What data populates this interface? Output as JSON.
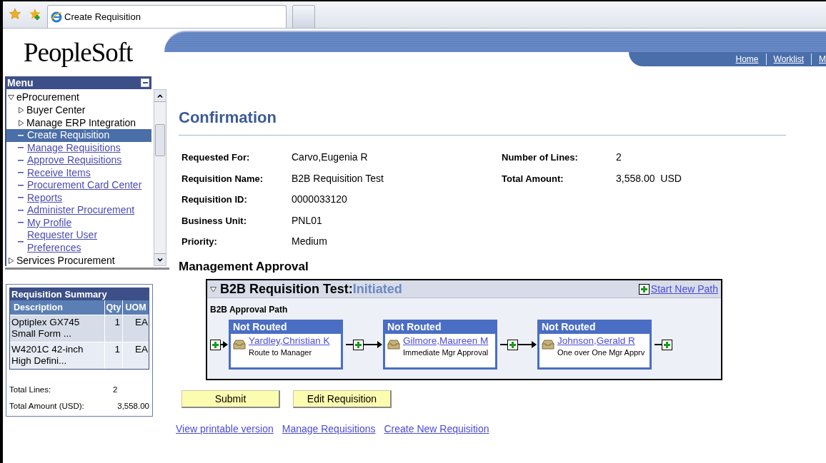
{
  "browser": {
    "tab_title": "Create Requisition"
  },
  "header": {
    "logo": "PeopleSoft",
    "nav_links": [
      "Home",
      "Worklist",
      "M"
    ]
  },
  "menu": {
    "title": "Menu",
    "items": [
      {
        "kind": "folder",
        "label": "eProcurement",
        "expanded": true,
        "children": [
          {
            "kind": "folder",
            "label": "Buyer Center",
            "expanded": false
          },
          {
            "kind": "folder",
            "label": "Manage ERP Integration",
            "expanded": false
          },
          {
            "kind": "link",
            "label": "Create Requisition",
            "selected": true
          },
          {
            "kind": "link",
            "label": "Manage Requisitions",
            "selected": false
          },
          {
            "kind": "link",
            "label": "Approve Requisitions",
            "selected": false
          },
          {
            "kind": "link",
            "label": "Receive Items",
            "selected": false
          },
          {
            "kind": "link",
            "label": "Procurement Card Center",
            "selected": false
          },
          {
            "kind": "link",
            "label": "Reports",
            "selected": false
          },
          {
            "kind": "link",
            "label": "Administer Procurement",
            "selected": false
          },
          {
            "kind": "link",
            "label": "My Profile",
            "selected": false
          },
          {
            "kind": "link",
            "label": "Requester User Preferences",
            "selected": false
          }
        ]
      },
      {
        "kind": "folder",
        "label": "Services Procurement",
        "expanded": false
      }
    ]
  },
  "summary": {
    "title": "Requisition Summary",
    "columns": [
      "Description",
      "Qty",
      "UOM"
    ],
    "rows": [
      [
        "Optiplex GX745 Small Form ...",
        "1",
        "EA"
      ],
      [
        "W4201C 42-inch High Defini...",
        "1",
        "EA"
      ]
    ],
    "totals": [
      {
        "label": "Total Lines:",
        "value": "2"
      },
      {
        "label": "Total Amount (USD):",
        "value": "3,558.00"
      }
    ]
  },
  "page": {
    "title": "Confirmation",
    "details_left": [
      {
        "label": "Requested For:",
        "value": "Carvo,Eugenia R"
      },
      {
        "label": "Requisition Name:",
        "value": "B2B Requisition Test"
      },
      {
        "label": "Requisition ID:",
        "value": "0000033120"
      },
      {
        "label": "Business Unit:",
        "value": "PNL01"
      },
      {
        "label": "Priority:",
        "value": "Medium"
      }
    ],
    "details_right": [
      {
        "label": "Number of Lines:",
        "value": "2"
      },
      {
        "label": "Total Amount:",
        "value": "3,558.00  USD"
      }
    ]
  },
  "approval": {
    "heading": "Management Approval",
    "title": "B2B Requisition Test:",
    "status": "Initiated",
    "expanded": true,
    "start_new_path": "Start New Path",
    "path_name": "B2B Approval Path",
    "steps": [
      {
        "status": "Not Routed",
        "approver": "Yardley,Christian K",
        "role": "Route to Manager"
      },
      {
        "status": "Not Routed",
        "approver": "Gilmore,Maureen M",
        "role": "Immediate Mgr Approval"
      },
      {
        "status": "Not Routed",
        "approver": "Johnson,Gerald R",
        "role": "One over One Mgr Apprv"
      }
    ]
  },
  "buttons": [
    "Submit",
    "Edit Requisition"
  ],
  "links": [
    "View printable version",
    "Manage Requisitions",
    "Create New Requisition"
  ]
}
